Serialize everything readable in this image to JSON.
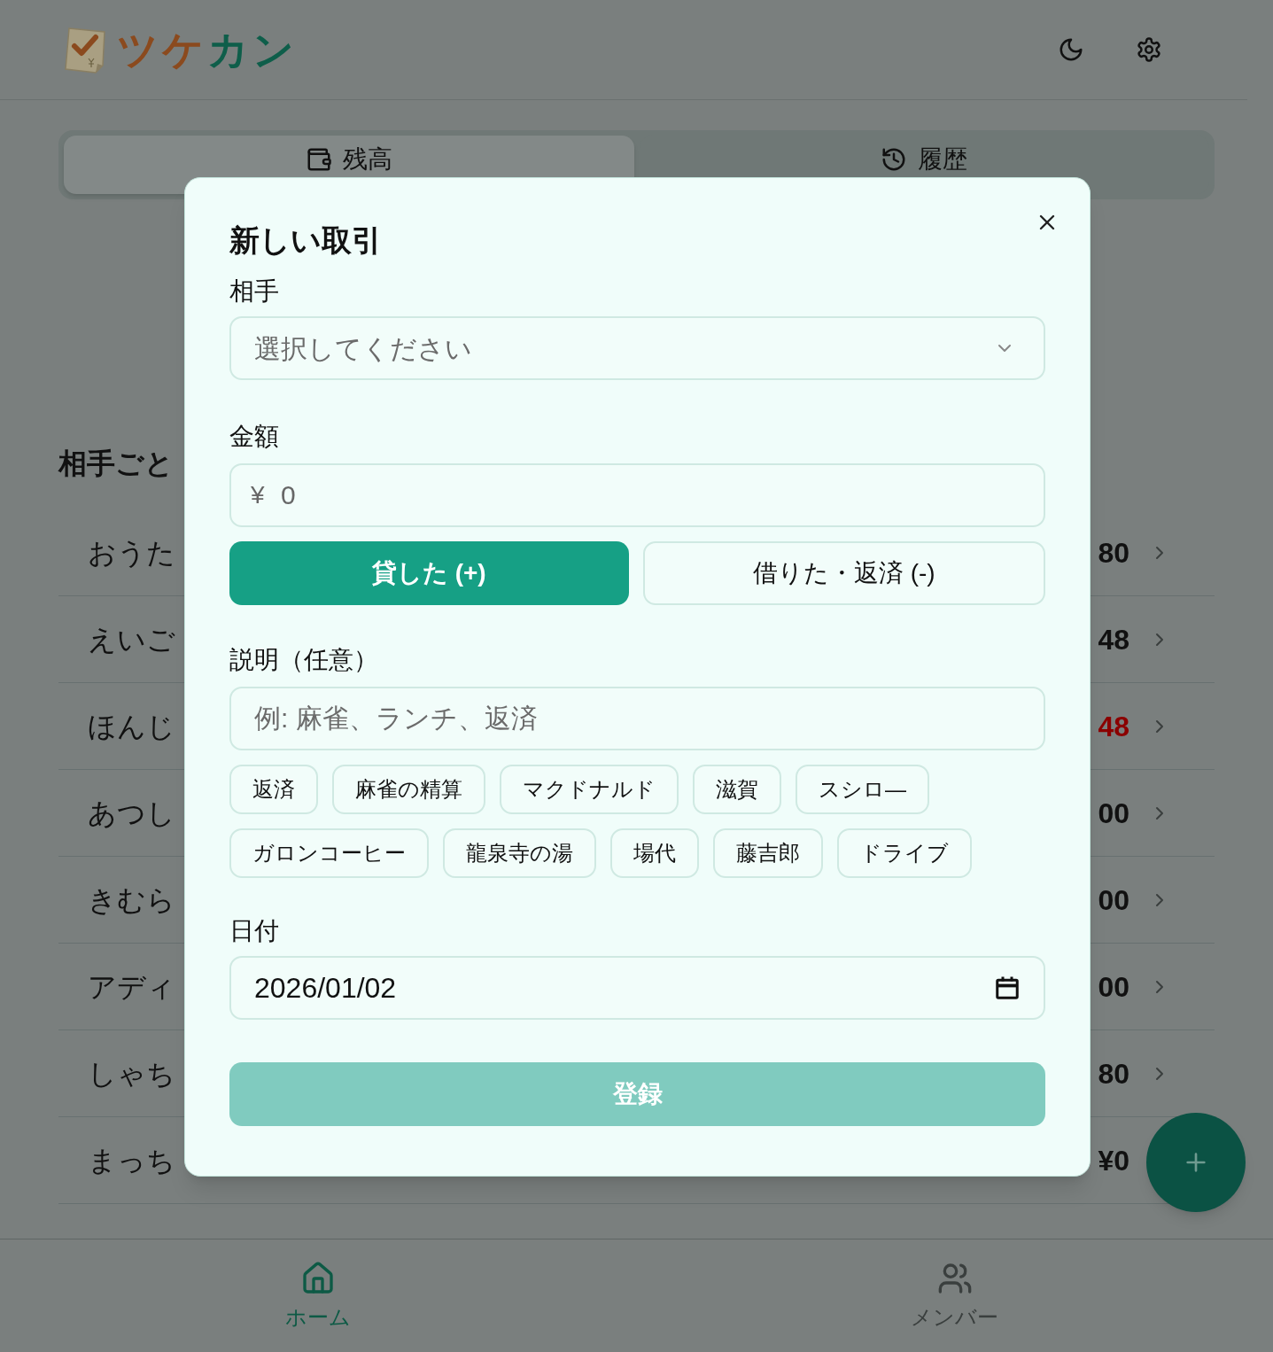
{
  "header": {
    "logo_parts": [
      {
        "text": "ツケ",
        "color": "#8b4a1e"
      },
      {
        "text": "カン",
        "color": "#0e5e4a"
      }
    ]
  },
  "tabs": [
    {
      "label": "残高",
      "kind": "wallet",
      "selected": true
    },
    {
      "label": "履歴",
      "kind": "history",
      "selected": false
    }
  ],
  "balance_section": {
    "title": "相手ごと",
    "rows": [
      {
        "name": "おうた",
        "amount": "80",
        "negative": false
      },
      {
        "name": "えいご",
        "amount": "48",
        "negative": false
      },
      {
        "name": "ほんじ",
        "amount": "48",
        "negative": true
      },
      {
        "name": "あつし",
        "amount": "00",
        "negative": false
      },
      {
        "name": "きむら",
        "amount": "00",
        "negative": false
      },
      {
        "name": "アディ",
        "amount": "00",
        "negative": false
      },
      {
        "name": "しゃち",
        "amount": "80",
        "negative": false
      },
      {
        "name": "まっち",
        "amount": "¥0",
        "negative": false
      }
    ]
  },
  "bottom_nav": [
    {
      "label": "ホーム",
      "kind": "home",
      "selected": true
    },
    {
      "label": "メンバー",
      "kind": "members",
      "selected": false
    }
  ],
  "dialog": {
    "title": "新しい取引",
    "partner": {
      "label": "相手",
      "placeholder": "選択してください"
    },
    "amount": {
      "label": "金額",
      "currency": "¥",
      "placeholder": "0"
    },
    "direction": [
      {
        "label": "貸した (+)",
        "selected": true
      },
      {
        "label": "借りた・返済 (-)",
        "selected": false
      }
    ],
    "description": {
      "label": "説明（任意）",
      "placeholder": "例: 麻雀、ランチ、返済"
    },
    "tags": [
      "返済",
      "麻雀の精算",
      "マクドナルド",
      "滋賀",
      "スシロ—",
      "ガロンコーヒー",
      "龍泉寺の湯",
      "場代",
      "藤吉郎",
      "ドライブ"
    ],
    "date": {
      "label": "日付",
      "value": "2026/01/02"
    },
    "submit": {
      "label": "登録",
      "disabled": true
    }
  }
}
